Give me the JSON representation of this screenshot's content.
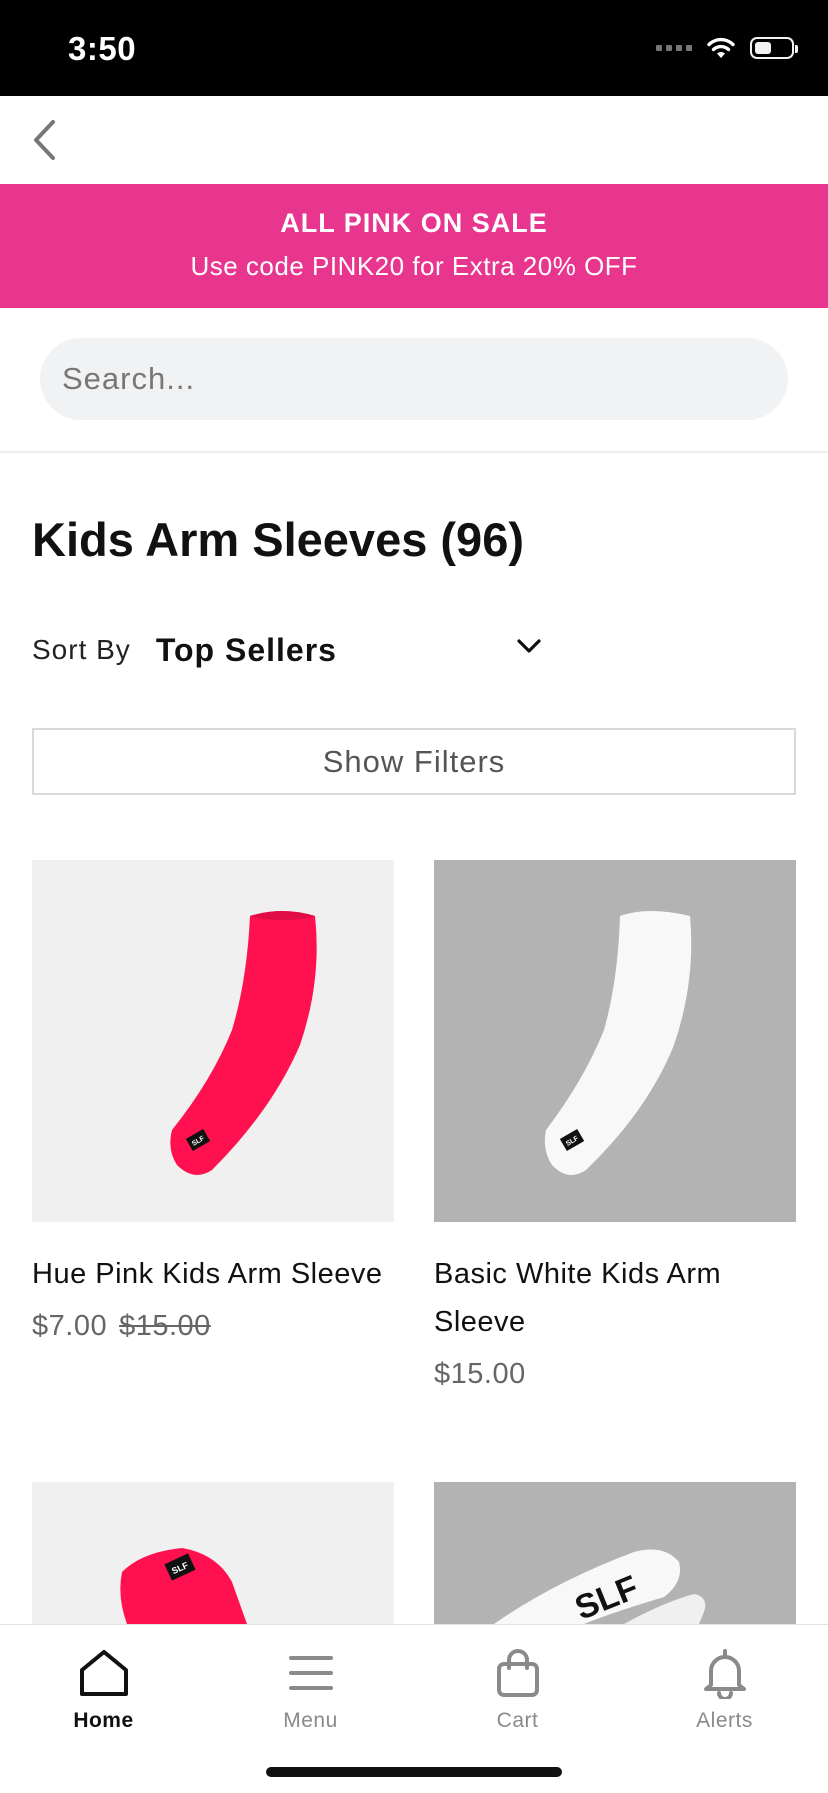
{
  "status_bar": {
    "time": "3:50"
  },
  "promo": {
    "title": "ALL PINK ON SALE",
    "subtitle": "Use code PINK20 for Extra 20% OFF",
    "background": "#e8368f"
  },
  "search": {
    "placeholder": "Search..."
  },
  "page_title": "Kids Arm Sleeves (96)",
  "sort": {
    "label": "Sort By",
    "value": "Top Sellers"
  },
  "filters_label": "Show Filters",
  "products": [
    {
      "name": "Hue Pink Kids Arm Sleeve",
      "price": "$7.00",
      "original_price": "$15.00",
      "image_color": "#ff1150",
      "image_bg": "#f0f0f0",
      "badge": "SLF"
    },
    {
      "name": "Basic White Kids Arm Sleeve",
      "price": "$15.00",
      "original_price": "",
      "image_color": "#ffffff",
      "image_bg": "#b3b3b3",
      "badge": "SLF"
    },
    {
      "name": "",
      "image_color": "#ff1150",
      "image_bg": "#f0f0f0",
      "badge": "SLF"
    },
    {
      "name": "",
      "image_color": "#ffffff",
      "image_bg": "#b3b3b3",
      "badge": "SLF"
    }
  ],
  "tabs": [
    {
      "label": "Home",
      "icon": "home-icon",
      "active": true
    },
    {
      "label": "Menu",
      "icon": "menu-icon",
      "active": false
    },
    {
      "label": "Cart",
      "icon": "cart-icon",
      "active": false
    },
    {
      "label": "Alerts",
      "icon": "bell-icon",
      "active": false
    }
  ]
}
